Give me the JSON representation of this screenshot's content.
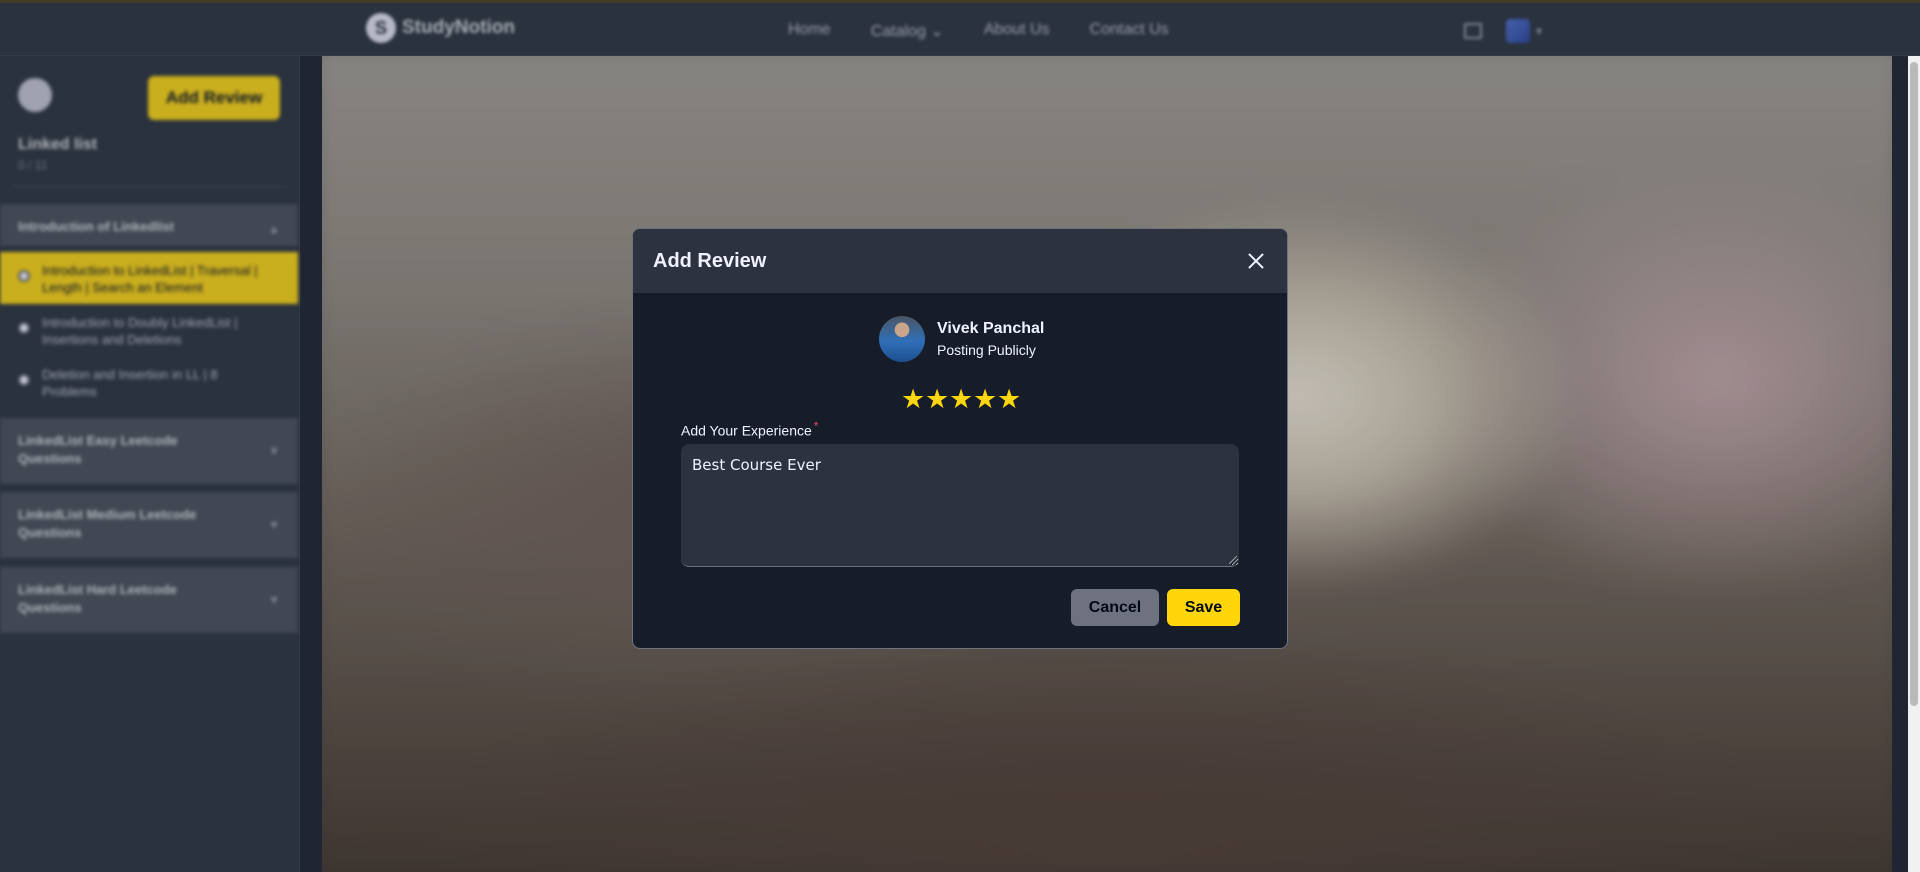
{
  "navbar": {
    "logo_text": "StudyNotion",
    "links": [
      "Home",
      "Catalog",
      "About Us",
      "Contact Us"
    ],
    "catalog_caret": "⌄"
  },
  "sidebar": {
    "add_review_label": "Add Review",
    "course_title": "Linked list",
    "progress": "0 / 11",
    "sections": [
      {
        "title": "Introduction of Linkedlist",
        "subsections": [
          "Introduction to LinkedList | Traversal | Length | Search an Element",
          "Introduction to Doubly LinkedList | Insertions and Deletions",
          "Deletion and Insertion in LL | 8 Problems"
        ]
      },
      {
        "title": "LinkedList Easy Leetcode Questions"
      },
      {
        "title": "LinkedList Medium Leetcode Questions"
      },
      {
        "title": "LinkedList Hard Leetcode Questions"
      }
    ]
  },
  "modal": {
    "title": "Add Review",
    "user_name": "Vivek Panchal",
    "user_subtitle": "Posting Publicly",
    "rating": 5,
    "stars": [
      "★",
      "★",
      "★",
      "★",
      "★"
    ],
    "experience_label": "Add Your Experience",
    "required_mark": "*",
    "experience_value": "Best Course Ever",
    "cancel_label": "Cancel",
    "save_label": "Save"
  },
  "colors": {
    "accent_yellow": "#ffd60a",
    "modal_bg": "#161d29",
    "modal_header": "#2c333f",
    "required_red": "#ef476f"
  }
}
